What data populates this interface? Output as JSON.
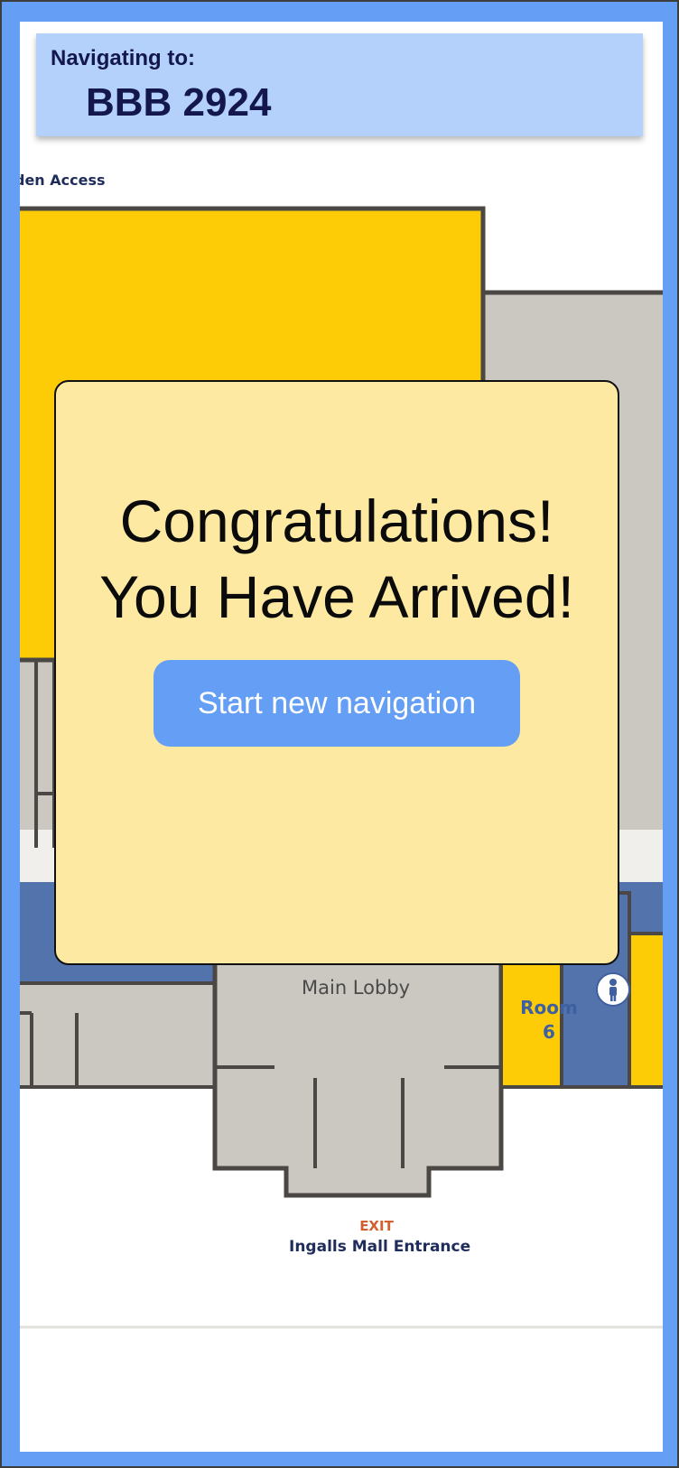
{
  "header": {
    "navigating_label": "Navigating to:",
    "destination": "BBB 2924"
  },
  "map": {
    "labels": {
      "partial_access": "den Access",
      "main_lobby": "Main Lobby",
      "room_line1": "Room",
      "room_line2": "6",
      "exit": "EXIT",
      "entrance": "Ingalls Mall Entrance"
    },
    "icons": [
      "restroom-icon"
    ],
    "colors": {
      "room_yellow": "#fdcc07",
      "floor_gray": "#cbc7c1",
      "corridor_blue": "#5273ab",
      "wall": "#4a4744"
    }
  },
  "modal": {
    "title_line1": "Congratulations!",
    "title_line2": "You Have Arrived!",
    "button_label": "Start new navigation"
  },
  "colors": {
    "frame": "#649ef5",
    "header_bg": "#b3d1fb",
    "header_text": "#13174d",
    "modal_bg": "#fde9a1",
    "button_bg": "#649ef5"
  }
}
